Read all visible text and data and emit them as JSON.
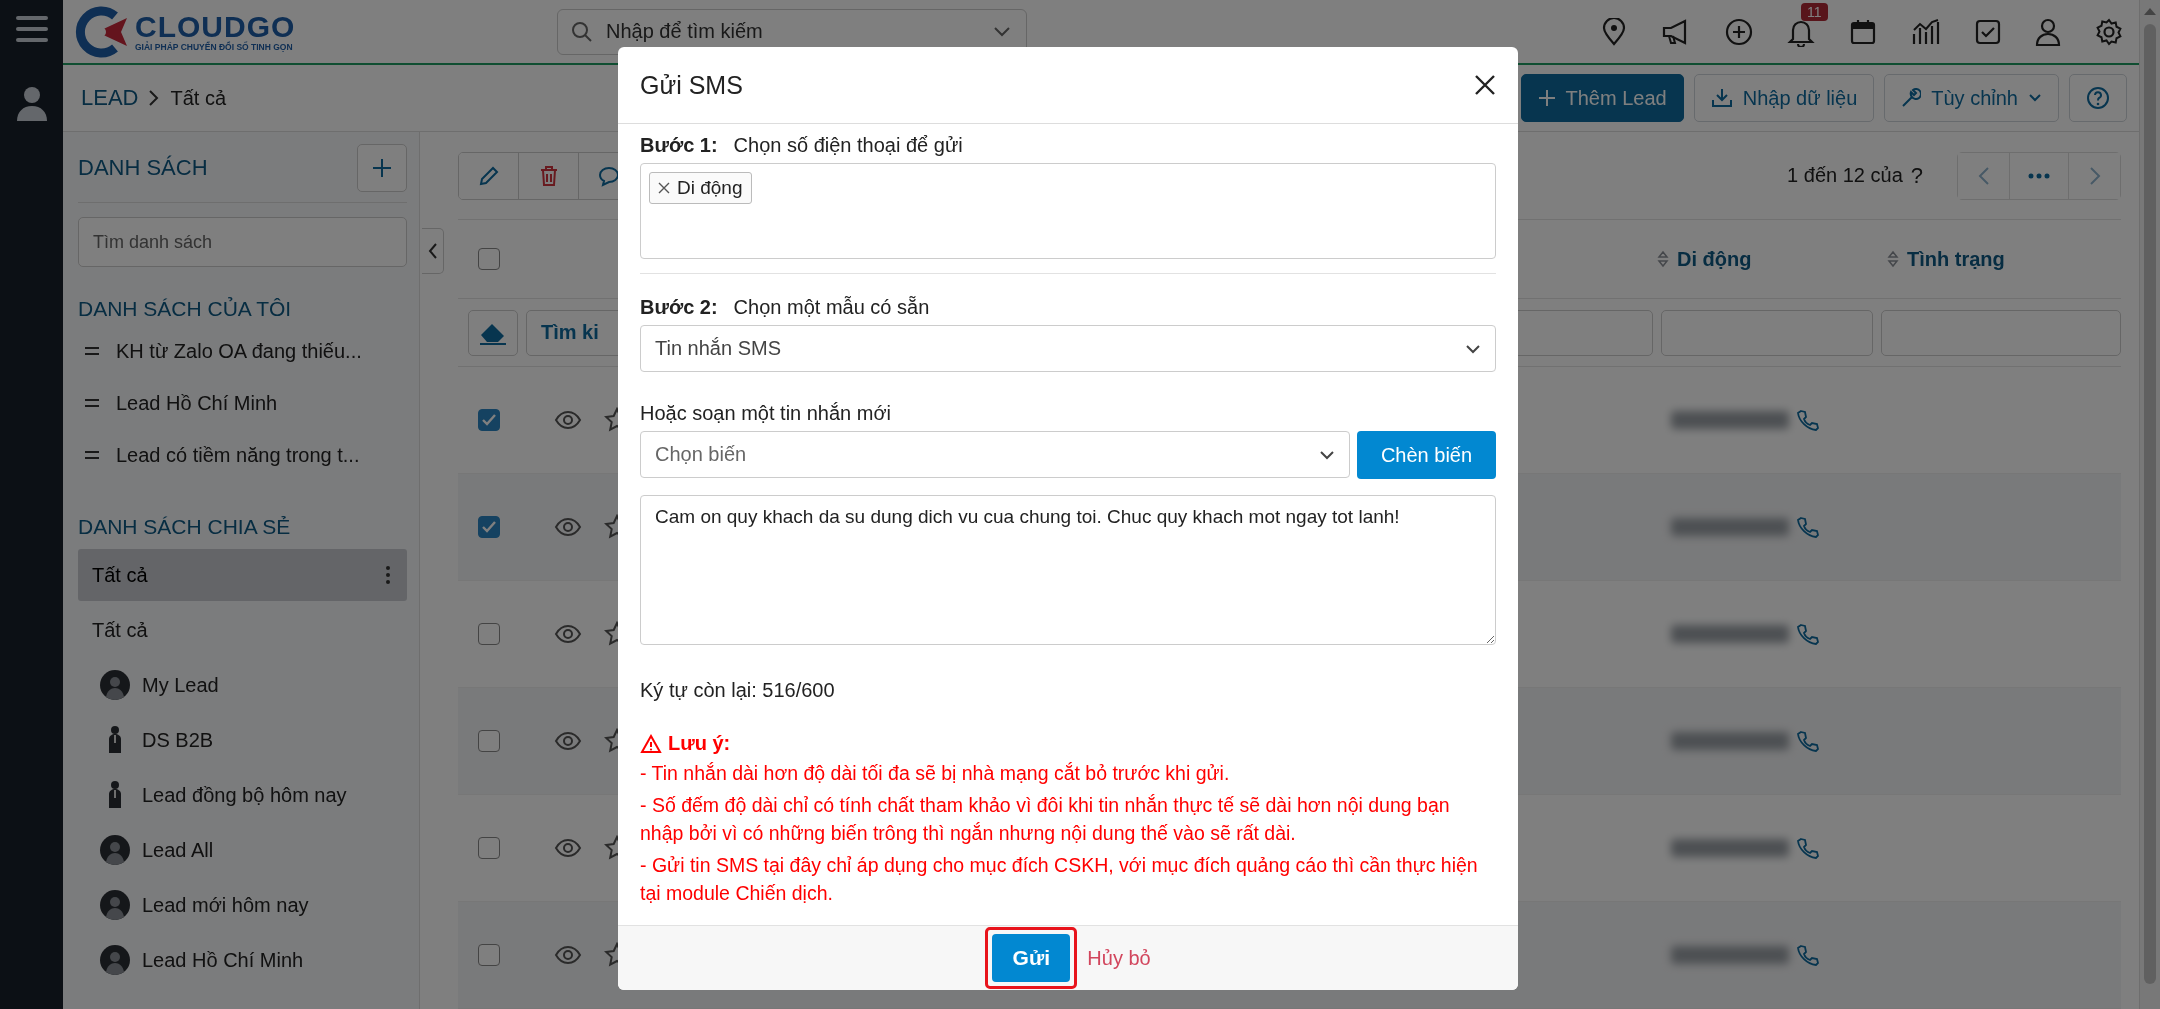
{
  "header": {
    "logo": {
      "name": "CLOUDGO",
      "tagline": "GIẢI PHÁP CHUYỂN ĐỔI SỐ TINH GỌN"
    },
    "search": {
      "placeholder": "Nhập để tìm kiếm"
    },
    "notification_count": "11"
  },
  "breadcrumb": {
    "module": "LEAD",
    "current": "Tất cả"
  },
  "actions": {
    "add": "Thêm Lead",
    "import": "Nhập dữ liệu",
    "customize": "Tùy chỉnh"
  },
  "sidebar": {
    "title": "DANH SÁCH",
    "search": {
      "placeholder": "Tìm danh sách"
    },
    "my_lists": {
      "title": "DANH SÁCH CỦA TÔI",
      "items": [
        {
          "label": "KH từ Zalo OA đang thiếu..."
        },
        {
          "label": "Lead Hồ Chí Minh"
        },
        {
          "label": "Lead có tiềm năng trong t..."
        }
      ]
    },
    "shared_lists": {
      "title": "DANH SÁCH CHIA SẺ",
      "items": [
        {
          "label": "Tất cả",
          "kind": "plain",
          "selected": true
        },
        {
          "label": "Tất cả",
          "kind": "plain",
          "selected": false
        },
        {
          "label": "My Lead",
          "kind": "avatar",
          "selected": false
        },
        {
          "label": "DS B2B",
          "kind": "figure",
          "selected": false
        },
        {
          "label": "Lead đồng bộ hôm nay",
          "kind": "figure",
          "selected": false
        },
        {
          "label": "Lead All",
          "kind": "avatar",
          "selected": false
        },
        {
          "label": "Lead mới hôm nay",
          "kind": "avatar",
          "selected": false
        },
        {
          "label": "Lead Hồ Chí Minh",
          "kind": "avatar",
          "selected": false
        }
      ]
    }
  },
  "toolbar": {
    "search_button": "Tìm ki",
    "range": "1 đến 12 của",
    "help": "?"
  },
  "table": {
    "columns": [
      "Di động",
      "Tình trạng"
    ],
    "header_checked": false,
    "rows": [
      {
        "checked": true
      },
      {
        "checked": true
      },
      {
        "checked": false
      },
      {
        "checked": false
      },
      {
        "checked": false
      },
      {
        "checked": false
      }
    ]
  },
  "modal": {
    "title": "Gửi SMS",
    "step1": {
      "label": "Bước 1:",
      "text": "Chọn số điện thoại để gửi",
      "tags": [
        "Di động"
      ]
    },
    "step2": {
      "label": "Bước 2:",
      "text": "Chọn một mẫu có sẵn",
      "value": "Tin nhắn SMS"
    },
    "compose": {
      "label": "Hoặc soạn một tin nhắn mới",
      "variable": {
        "placeholder": "Chọn biến"
      },
      "insert_button": "Chèn biến",
      "message": "Cam on quy khach da su dung dich vu cua chung toi. Chuc quy khach mot ngay tot lanh!"
    },
    "counter": "Ký tự còn lại: 516/600",
    "notice": {
      "title": "Lưu ý:",
      "lines": [
        "- Tin nhắn dài hơn độ dài tối đa sẽ bị nhà mạng cắt bỏ trước khi gửi.",
        "- Số đếm độ dài chỉ có tính chất tham khảo vì đôi khi tin nhắn thực tế sẽ dài hơn nội dung bạn nhập bởi vì có những biến trông thì ngắn nhưng nội dung thế vào sẽ rất dài.",
        "- Gửi tin SMS tại đây chỉ áp dụng cho mục đích CSKH, với mục đích quảng cáo thì cần thực hiện tại module Chiến dịch."
      ]
    },
    "send": {
      "label": "Gửi",
      "highlighted": true
    },
    "cancel": "Hủy bỏ"
  }
}
